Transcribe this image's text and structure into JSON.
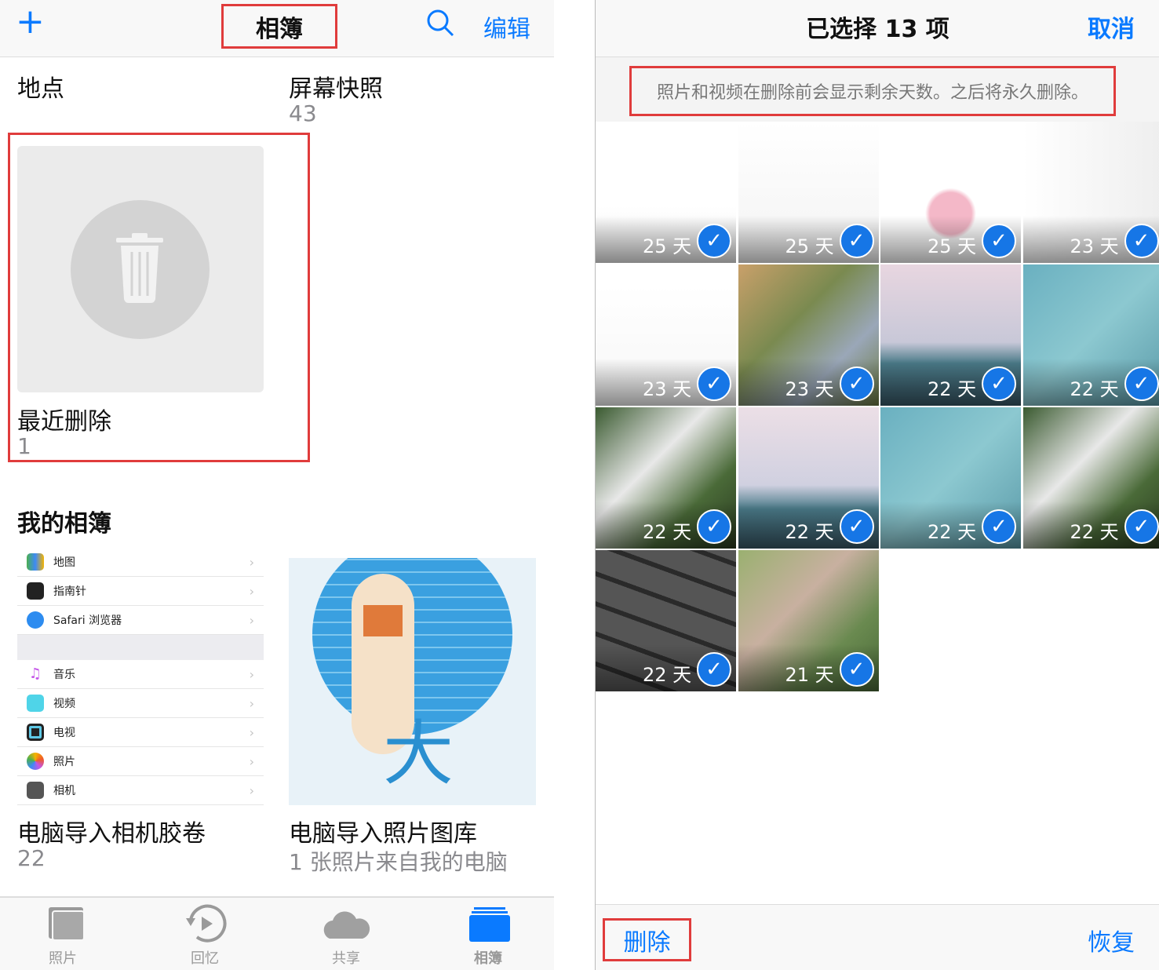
{
  "left": {
    "header": {
      "add_icon": "plus-icon",
      "title": "相簿",
      "search_icon": "search-icon",
      "edit": "编辑"
    },
    "top_albums": [
      {
        "name": "地点"
      },
      {
        "name": "屏幕快照",
        "count": "43"
      }
    ],
    "recently_deleted": {
      "name": "最近删除",
      "count": "1",
      "icon": "trash-icon"
    },
    "my_albums_title": "我的相簿",
    "settings_rows": [
      "地图",
      "指南针",
      "Safari 浏览器",
      "音乐",
      "视频",
      "电视",
      "照片",
      "相机"
    ],
    "albums": [
      {
        "name": "电脑导入相机胶卷",
        "count": "22"
      },
      {
        "name": "电脑导入照片图库",
        "count": "1 张照片来自我的电脑"
      }
    ],
    "thumb_glyph": "大",
    "tabs": [
      {
        "label": "照片",
        "icon": "photos-icon"
      },
      {
        "label": "回忆",
        "icon": "memories-icon"
      },
      {
        "label": "共享",
        "icon": "cloud-icon"
      },
      {
        "label": "相簿",
        "icon": "albums-icon",
        "active": true
      }
    ]
  },
  "right": {
    "header": {
      "title": "已选择 13 项",
      "cancel": "取消"
    },
    "notice": "照片和视频在删除前会显示剩余天数。之后将永久删除。",
    "items": [
      {
        "days": "25 天",
        "selected": true
      },
      {
        "days": "25 天",
        "selected": true
      },
      {
        "days": "25 天",
        "selected": true
      },
      {
        "days": "23 天",
        "selected": true
      },
      {
        "days": "23 天",
        "selected": true
      },
      {
        "days": "23 天",
        "selected": true
      },
      {
        "days": "22 天",
        "selected": true
      },
      {
        "days": "22 天",
        "selected": true
      },
      {
        "days": "22 天",
        "selected": true
      },
      {
        "days": "22 天",
        "selected": true
      },
      {
        "days": "22 天",
        "selected": true
      },
      {
        "days": "22 天",
        "selected": true
      },
      {
        "days": "22 天",
        "selected": true
      },
      {
        "days": "21 天",
        "selected": true
      }
    ],
    "footer": {
      "delete": "删除",
      "recover": "恢复"
    }
  },
  "colors": {
    "accent": "#0a7aff",
    "highlight": "#e03c3c",
    "check": "#1676e6"
  }
}
